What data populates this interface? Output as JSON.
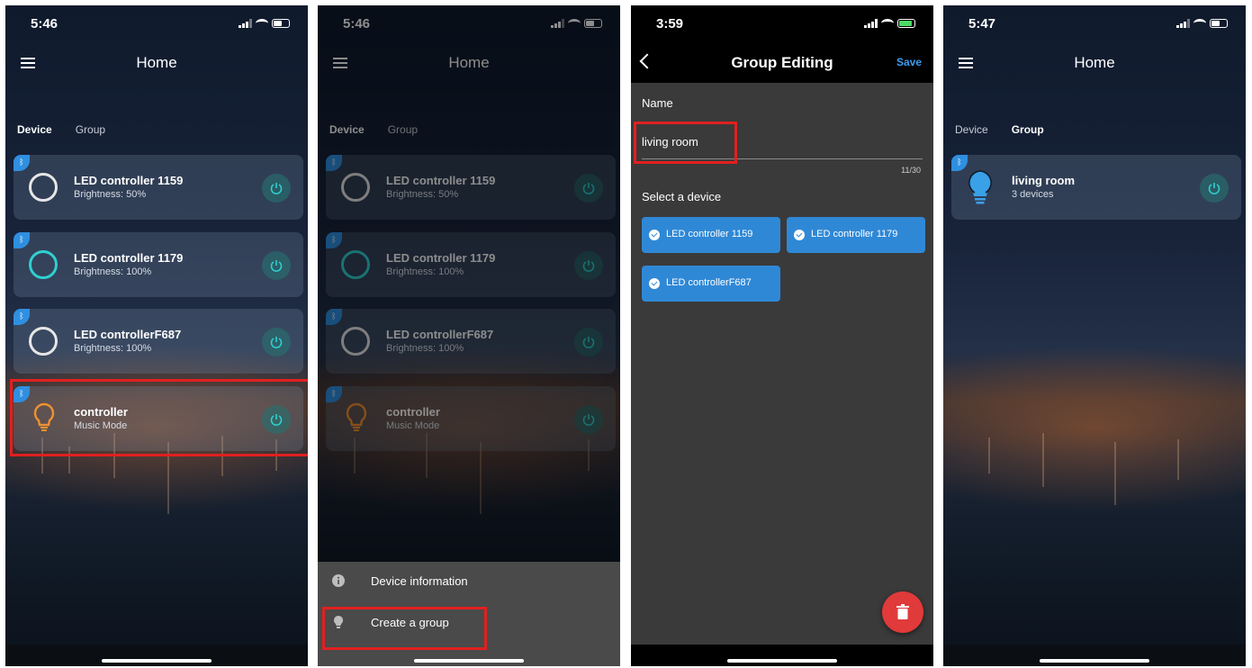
{
  "screens": [
    {
      "time": "5:46",
      "title": "Home",
      "tabs": {
        "device": "Device",
        "group": "Group",
        "active": "device"
      },
      "devices": [
        {
          "name": "LED controller 1159",
          "status": "Brightness: 50%",
          "icon": "ring-white-icon"
        },
        {
          "name": "LED controller 1179",
          "status": "Brightness: 100%",
          "icon": "ring-teal-icon"
        },
        {
          "name": "LED controllerF687",
          "status": "Brightness: 100%",
          "icon": "ring-white-icon"
        },
        {
          "name": "controller",
          "status": "Music Mode",
          "icon": "bulb-orange-icon"
        }
      ]
    },
    {
      "time": "5:46",
      "title": "Home",
      "tabs": {
        "device": "Device",
        "group": "Group"
      },
      "devices": [
        {
          "name": "LED controller 1159",
          "status": "Brightness: 50%"
        },
        {
          "name": "LED controller 1179",
          "status": "Brightness: 100%"
        },
        {
          "name": "LED controllerF687",
          "status": "Brightness: 100%"
        },
        {
          "name": "controller",
          "status": "Music Mode"
        }
      ],
      "menu": [
        {
          "label": "Device information",
          "icon": "info-icon"
        },
        {
          "label": "Create a group",
          "icon": "bulb-icon"
        }
      ]
    },
    {
      "time": "3:59",
      "title": "Group Editing",
      "save": "Save",
      "name_label": "Name",
      "name_value": "living room",
      "counter": "11/30",
      "select_label": "Select a device",
      "chips": [
        "LED controller 1159",
        "LED controller 1179",
        "LED controllerF687"
      ]
    },
    {
      "time": "5:47",
      "title": "Home",
      "tabs": {
        "device": "Device",
        "group": "Group",
        "active": "group"
      },
      "groups": [
        {
          "name": "living room",
          "count": "3 devices",
          "icon": "bulb-blue-icon"
        }
      ]
    }
  ],
  "colors": {
    "accent_blue": "#2f88d6",
    "highlight_red": "#e02020",
    "fab_red": "#e03a3a",
    "teal": "#2fd0d0"
  }
}
